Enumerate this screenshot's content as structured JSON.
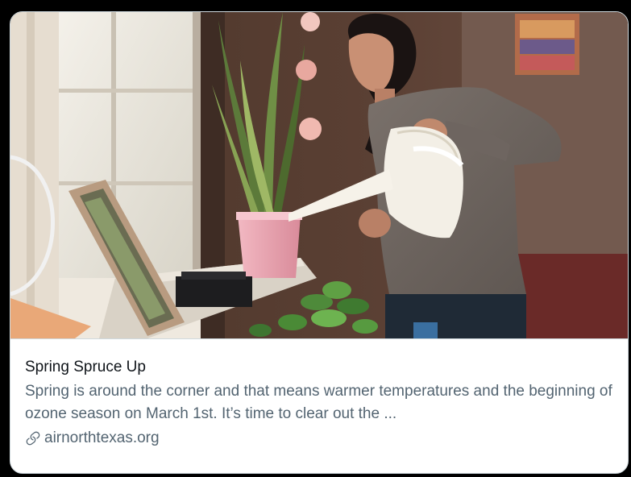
{
  "card": {
    "image_alt": "Woman watering a plant with a white watering can by a sunny window",
    "title": "Spring Spruce Up",
    "description": "Spring is around the corner and that means warmer temperatures and the beginning of ozone season on March 1st. It’s time to clear out the ...",
    "domain": "airnorthtexas.org",
    "link_icon": "link-icon"
  },
  "colors": {
    "title": "#0f1419",
    "secondary_text": "#536471",
    "border": "#cfd9de",
    "background": "#ffffff"
  }
}
